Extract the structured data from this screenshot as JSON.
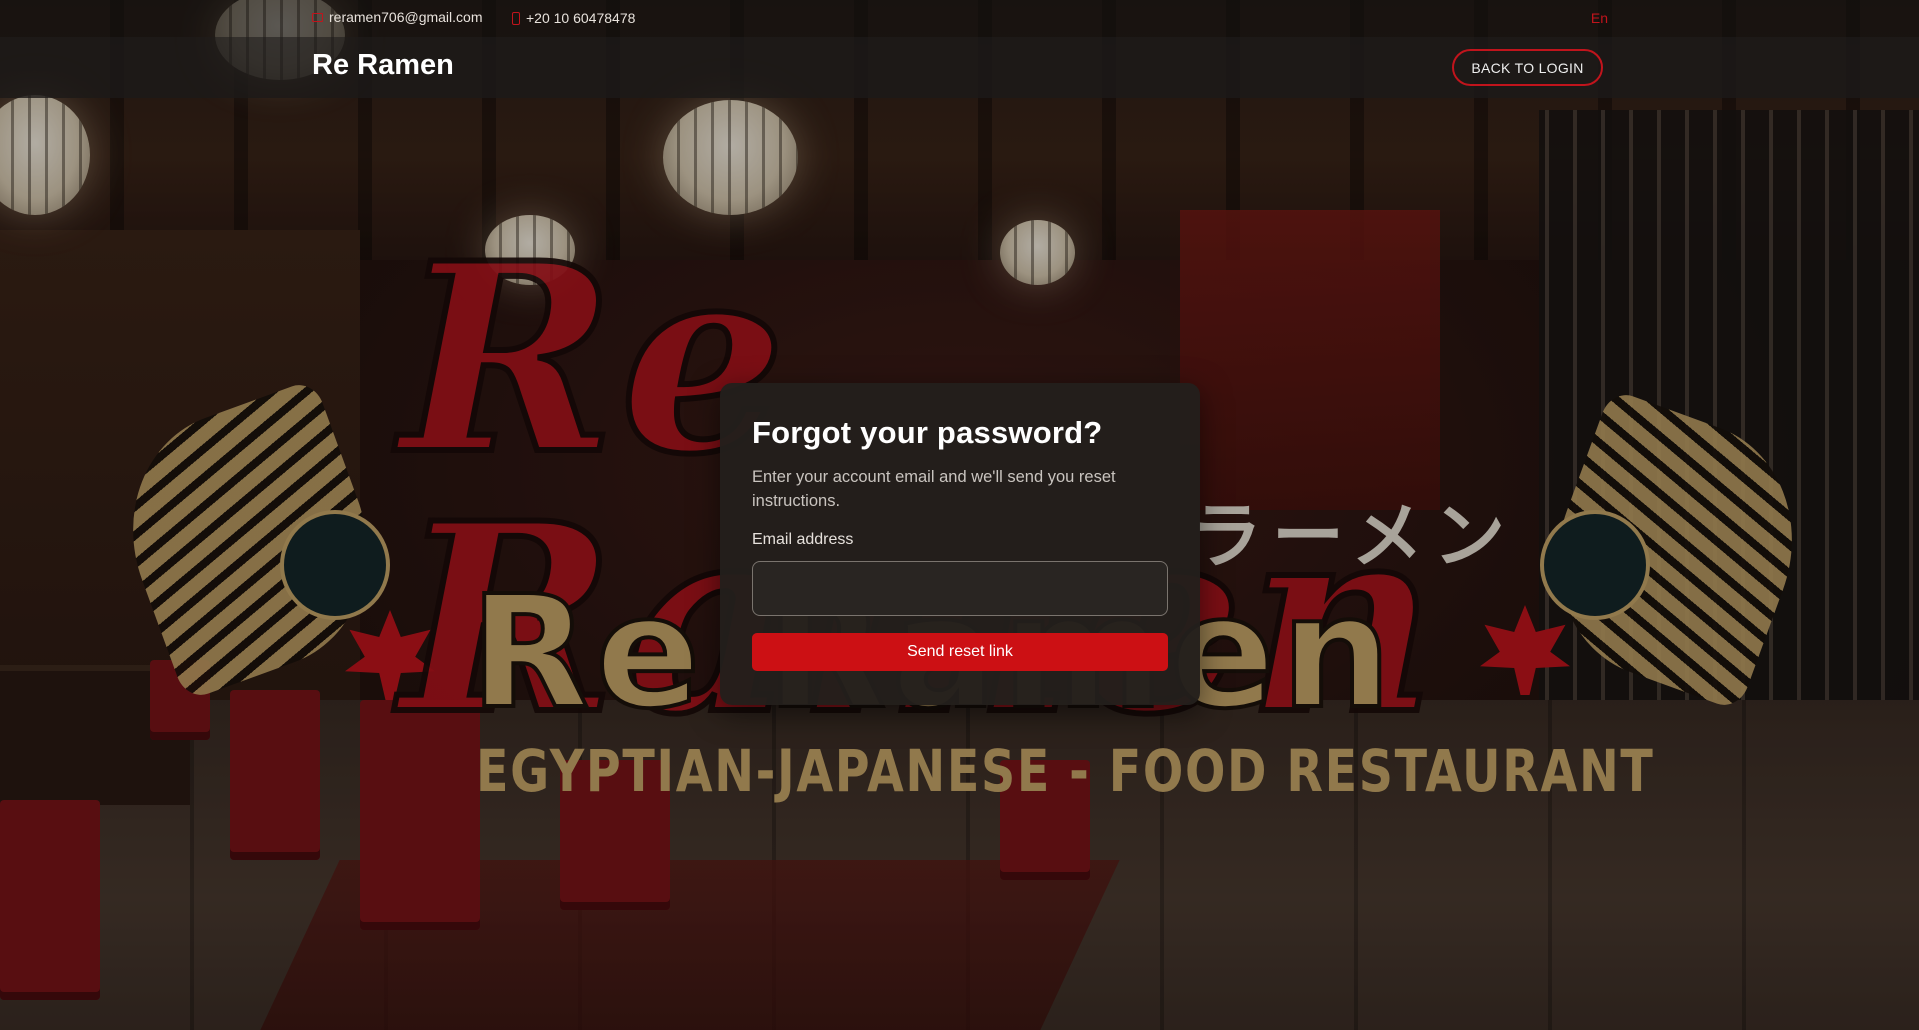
{
  "topbar": {
    "email": "reramen706@gmail.com",
    "phone": "+20 10 60478478",
    "language": "En",
    "email_icon": "mail-icon",
    "phone_icon": "phone-icon"
  },
  "navbar": {
    "brand": "Re Ramen",
    "back_button": "BACK TO LOGIN"
  },
  "background": {
    "logo_top": "Re Ramen",
    "logo_bottom": "Re Ramen",
    "logo_tagline": "EGYPTIAN-JAPANESE - FOOD  RESTAURANT",
    "logo_japanese": "ラーメン"
  },
  "form": {
    "title": "Forgot your password?",
    "description": "Enter your account email and we'll send you reset instructions.",
    "email_label": "Email address",
    "email_value": "",
    "email_placeholder": "",
    "submit_label": "Send reset link"
  },
  "colors": {
    "accent": "#cc1014",
    "card_bg": "#231f1c",
    "navbar_bg": "#1c1a18"
  }
}
